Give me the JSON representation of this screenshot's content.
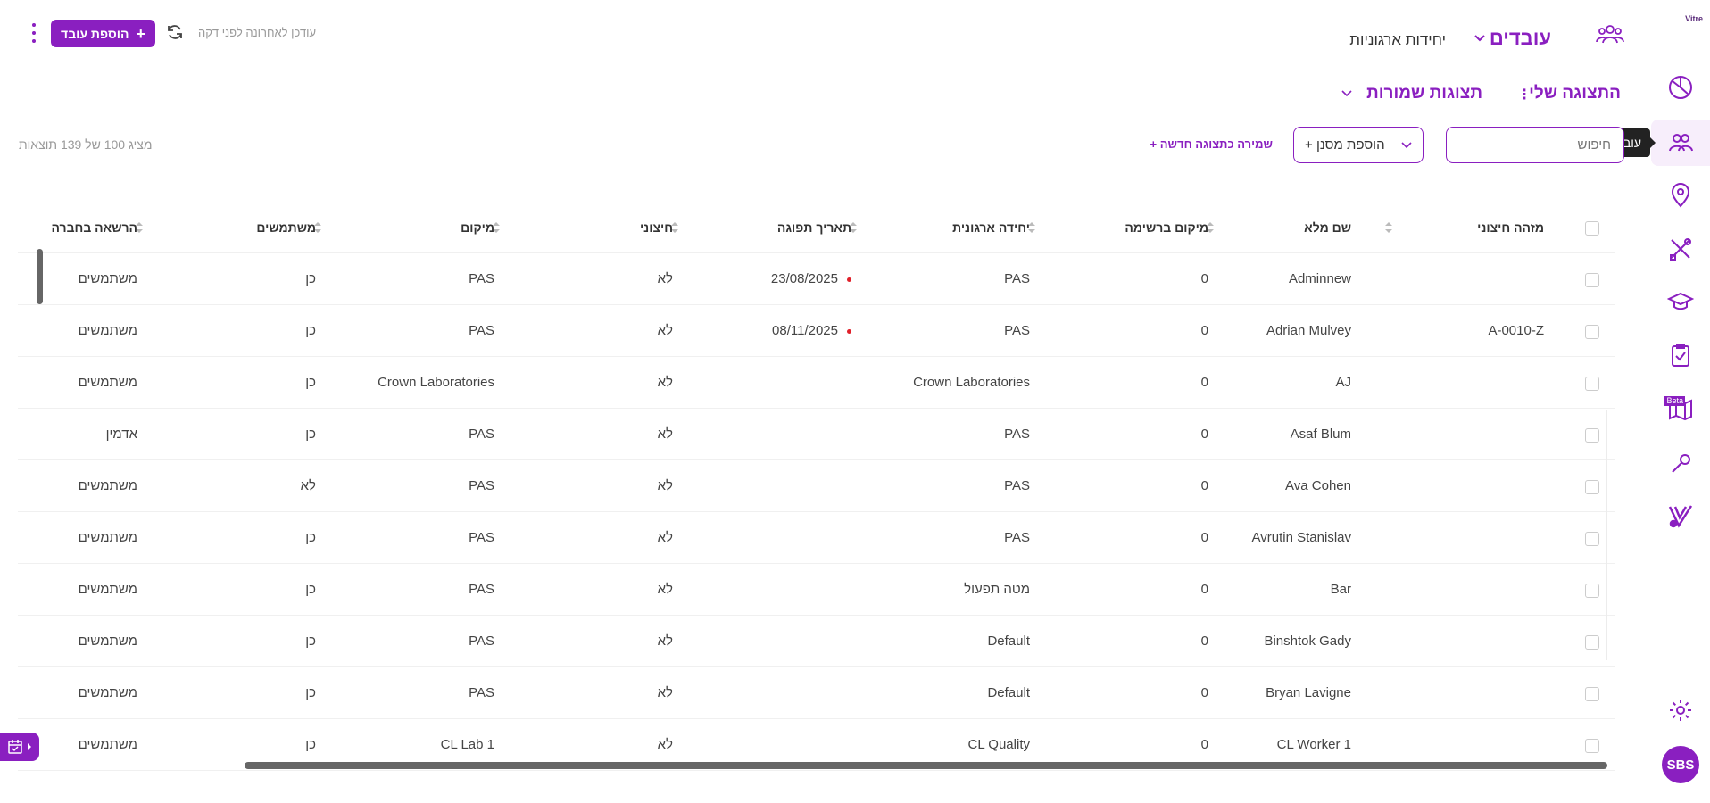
{
  "sidebar": {
    "logo_text": "Vitre",
    "tooltip": "עובדים",
    "beta_label": "Beta",
    "avatar": "SBS",
    "accent": "#8a1fc0"
  },
  "header": {
    "tab_employees": "עובדים",
    "tab_units": "יחידות ארגוניות",
    "updated_text": "עודכן לאחרונה לפני דקה",
    "add_button": "הוספת עובד"
  },
  "views": {
    "my_view": "התצוגה שלי",
    "saved_views": "תצוגות שמורות"
  },
  "filters": {
    "search_placeholder": "חיפוש",
    "add_filter": "+ הוספת מסנן",
    "save_view": "+ שמירה כתצוגה חדשה",
    "results": "מציג 100 של 139 תוצאות"
  },
  "table": {
    "headers": {
      "external_id": "מזהה חיצוני",
      "full_name": "שם מלא",
      "list_position": "מיקום ברשימה",
      "org_unit": "יחידה ארגונית",
      "expiry": "תאריך תפוגה",
      "external": "חיצוני",
      "location": "מיקום",
      "users": "משתמשים",
      "permission": "הרשאה בחברה"
    },
    "rows": [
      {
        "external_id": "",
        "full_name": "Adminnew",
        "list_position": "0",
        "org_unit": "PAS",
        "expiry": "23/08/2025",
        "external": "לא",
        "location": "PAS",
        "users": "כן",
        "permission": "משתמשים"
      },
      {
        "external_id": "A-0010-Z",
        "full_name": "Adrian Mulvey",
        "list_position": "0",
        "org_unit": "PAS",
        "expiry": "08/11/2025",
        "external": "לא",
        "location": "PAS",
        "users": "כן",
        "permission": "משתמשים"
      },
      {
        "external_id": "",
        "full_name": "AJ",
        "list_position": "0",
        "org_unit": "Crown Laboratories",
        "expiry": "",
        "external": "לא",
        "location": "Crown Laboratories",
        "users": "כן",
        "permission": "משתמשים"
      },
      {
        "external_id": "",
        "full_name": "Asaf Blum",
        "list_position": "0",
        "org_unit": "PAS",
        "expiry": "",
        "external": "לא",
        "location": "PAS",
        "users": "כן",
        "permission": "אדמין"
      },
      {
        "external_id": "",
        "full_name": "Ava Cohen",
        "list_position": "0",
        "org_unit": "PAS",
        "expiry": "",
        "external": "לא",
        "location": "PAS",
        "users": "לא",
        "permission": "משתמשים"
      },
      {
        "external_id": "",
        "full_name": "Avrutin Stanislav",
        "list_position": "0",
        "org_unit": "PAS",
        "expiry": "",
        "external": "לא",
        "location": "PAS",
        "users": "כן",
        "permission": "משתמשים"
      },
      {
        "external_id": "",
        "full_name": "Bar",
        "list_position": "0",
        "org_unit": "מטה תפעול",
        "expiry": "",
        "external": "לא",
        "location": "PAS",
        "users": "כן",
        "permission": "משתמשים"
      },
      {
        "external_id": "",
        "full_name": "Binshtok Gady",
        "list_position": "0",
        "org_unit": "Default",
        "expiry": "",
        "external": "לא",
        "location": "PAS",
        "users": "כן",
        "permission": "משתמשים"
      },
      {
        "external_id": "",
        "full_name": "Bryan Lavigne",
        "list_position": "0",
        "org_unit": "Default",
        "expiry": "",
        "external": "לא",
        "location": "PAS",
        "users": "כן",
        "permission": "משתמשים"
      },
      {
        "external_id": "",
        "full_name": "CL Worker 1",
        "list_position": "0",
        "org_unit": "CL Quality",
        "expiry": "",
        "external": "לא",
        "location": "CL Lab 1",
        "users": "כן",
        "permission": "משתמשים"
      }
    ]
  }
}
